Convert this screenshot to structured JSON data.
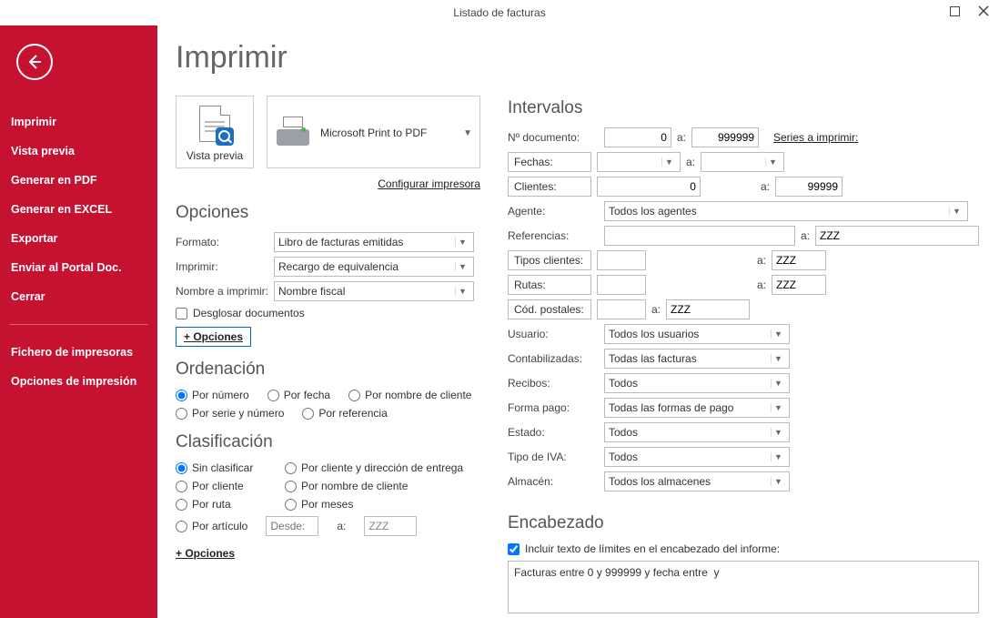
{
  "window": {
    "title": "Listado de facturas"
  },
  "sidebar": {
    "items": [
      "Imprimir",
      "Vista previa",
      "Generar en PDF",
      "Generar en EXCEL",
      "Exportar",
      "Enviar al Portal Doc.",
      "Cerrar"
    ],
    "footer": [
      "Fichero de impresoras",
      "Opciones de impresión"
    ]
  },
  "page": {
    "heading": "Imprimir",
    "preview_label": "Vista previa",
    "printer_name": "Microsoft Print to PDF",
    "config_printer": "Configurar impresora"
  },
  "opciones": {
    "title": "Opciones",
    "formato_lbl": "Formato:",
    "formato": "Libro de facturas emitidas",
    "imprimir_lbl": "Imprimir:",
    "imprimir": "Recargo de equivalencia",
    "nombre_lbl": "Nombre a imprimir:",
    "nombre": "Nombre fiscal",
    "desglosar": "Desglosar documentos",
    "mas": "+ Opciones"
  },
  "orden": {
    "title": "Ordenación",
    "opts": [
      "Por número",
      "Por fecha",
      "Por nombre de cliente",
      "Por serie y número",
      "Por referencia"
    ]
  },
  "clas": {
    "title": "Clasificación",
    "opts": [
      "Sin clasificar",
      "Por cliente y dirección de entrega",
      "Por cliente",
      "Por nombre de cliente",
      "Por ruta",
      "Por meses",
      "Por artículo"
    ],
    "desde_ph": "Desde:",
    "a_lbl": "a:",
    "zzz": "ZZZ",
    "mas": "+ Opciones"
  },
  "intervalos": {
    "title": "Intervalos",
    "ndoc_lbl": "Nº documento:",
    "ndoc_from": "0",
    "ndoc_to": "999999",
    "series": "Series a imprimir:",
    "fechas_btn": "Fechas:",
    "clientes_btn": "Clientes:",
    "cli_from": "0",
    "cli_to": "99999",
    "agente_lbl": "Agente:",
    "agente": "Todos los agentes",
    "ref_lbl": "Referencias:",
    "ref_to": "ZZZ",
    "tipos_btn": "Tipos clientes:",
    "tipos_to": "ZZZ",
    "rutas_btn": "Rutas:",
    "rutas_to": "ZZZ",
    "codpost_btn": "Cód. postales:",
    "cp_to": "ZZZ",
    "usuario_lbl": "Usuario:",
    "usuario": "Todos los usuarios",
    "contab_lbl": "Contabilizadas:",
    "contab": "Todas las facturas",
    "recibos_lbl": "Recibos:",
    "recibos": "Todos",
    "fpago_lbl": "Forma pago:",
    "fpago": "Todas las formas de pago",
    "estado_lbl": "Estado:",
    "estado": "Todos",
    "iva_lbl": "Tipo de IVA:",
    "iva": "Todos",
    "almacen_lbl": "Almacén:",
    "almacen": "Todos los almacenes",
    "a": "a:"
  },
  "encabezado": {
    "title": "Encabezado",
    "chk": "Incluir texto de límites en el encabezado del informe:",
    "text": "Facturas entre 0 y 999999 y fecha entre  y"
  }
}
